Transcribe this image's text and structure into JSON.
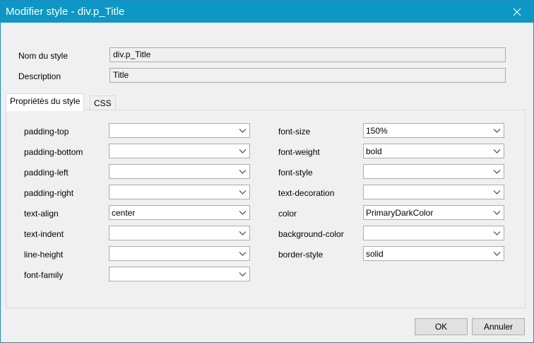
{
  "window": {
    "title": "Modifier style - div.p_Title",
    "close_icon": "close-icon"
  },
  "form": {
    "style_name_label": "Nom du style",
    "style_name_value": "div.p_Title",
    "description_label": "Description",
    "description_value": "Title"
  },
  "tabs": [
    {
      "label": "Propriétés du style",
      "active": true
    },
    {
      "label": "CSS",
      "active": false
    }
  ],
  "properties_left": [
    {
      "label": "padding-top",
      "value": ""
    },
    {
      "label": "padding-bottom",
      "value": ""
    },
    {
      "label": "padding-left",
      "value": ""
    },
    {
      "label": "padding-right",
      "value": ""
    },
    {
      "label": "text-align",
      "value": "center"
    },
    {
      "label": "text-indent",
      "value": ""
    },
    {
      "label": "line-height",
      "value": ""
    },
    {
      "label": "font-family",
      "value": ""
    }
  ],
  "properties_right": [
    {
      "label": "font-size",
      "value": "150%"
    },
    {
      "label": "font-weight",
      "value": "bold"
    },
    {
      "label": "font-style",
      "value": ""
    },
    {
      "label": "text-decoration",
      "value": ""
    },
    {
      "label": "color",
      "value": "PrimaryDarkColor"
    },
    {
      "label": "background-color",
      "value": ""
    },
    {
      "label": "border-style",
      "value": "solid"
    }
  ],
  "buttons": {
    "ok": "OK",
    "cancel": "Annuler"
  },
  "colors": {
    "titlebar": "#0c97c6",
    "dialog_bg": "#f0f0f0"
  }
}
